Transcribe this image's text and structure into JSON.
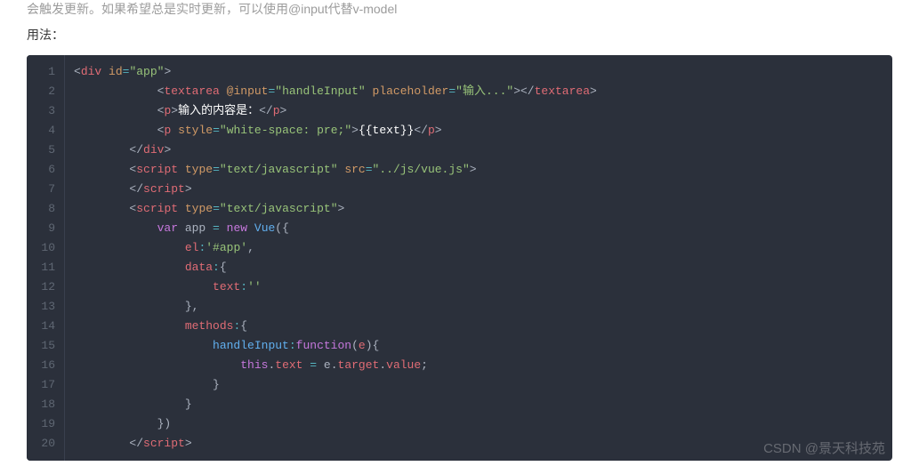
{
  "article": {
    "cutoff_text": "会触发更新。如果希望总是实时更新，可以使用@input代替v-model",
    "usage_label": "用法："
  },
  "code": {
    "line_count": 20,
    "lines": [
      {
        "n": 1,
        "tokens": [
          [
            "punc",
            "<"
          ],
          [
            "tag",
            "div"
          ],
          [
            "punc",
            " "
          ],
          [
            "attr",
            "id"
          ],
          [
            "op",
            "="
          ],
          [
            "str",
            "\"app\""
          ],
          [
            "punc",
            ">"
          ]
        ]
      },
      {
        "n": 2,
        "indent": 3,
        "tokens": [
          [
            "punc",
            "<"
          ],
          [
            "tag",
            "textarea"
          ],
          [
            "punc",
            " "
          ],
          [
            "attr",
            "@input"
          ],
          [
            "op",
            "="
          ],
          [
            "str",
            "\"handleInput\""
          ],
          [
            "punc",
            " "
          ],
          [
            "attr",
            "placeholder"
          ],
          [
            "op",
            "="
          ],
          [
            "str",
            "\"输入...\""
          ],
          [
            "punc",
            "></"
          ],
          [
            "tag",
            "textarea"
          ],
          [
            "punc",
            ">"
          ]
        ]
      },
      {
        "n": 3,
        "indent": 3,
        "tokens": [
          [
            "punc",
            "<"
          ],
          [
            "tag",
            "p"
          ],
          [
            "punc",
            ">"
          ],
          [
            "txt",
            "输入的内容是："
          ],
          [
            "punc",
            "</"
          ],
          [
            "tag",
            "p"
          ],
          [
            "punc",
            ">"
          ]
        ]
      },
      {
        "n": 4,
        "indent": 3,
        "tokens": [
          [
            "punc",
            "<"
          ],
          [
            "tag",
            "p"
          ],
          [
            "punc",
            " "
          ],
          [
            "attr",
            "style"
          ],
          [
            "op",
            "="
          ],
          [
            "str",
            "\"white-space: pre;\""
          ],
          [
            "punc",
            ">"
          ],
          [
            "txt",
            "{{text}}"
          ],
          [
            "punc",
            "</"
          ],
          [
            "tag",
            "p"
          ],
          [
            "punc",
            ">"
          ]
        ]
      },
      {
        "n": 5,
        "indent": 2,
        "tokens": [
          [
            "punc",
            "</"
          ],
          [
            "tag",
            "div"
          ],
          [
            "punc",
            ">"
          ]
        ]
      },
      {
        "n": 6,
        "indent": 2,
        "tokens": [
          [
            "punc",
            "<"
          ],
          [
            "tag",
            "script"
          ],
          [
            "punc",
            " "
          ],
          [
            "attr",
            "type"
          ],
          [
            "op",
            "="
          ],
          [
            "str",
            "\"text/javascript\""
          ],
          [
            "punc",
            " "
          ],
          [
            "attr",
            "src"
          ],
          [
            "op",
            "="
          ],
          [
            "str",
            "\"../js/vue.js\""
          ],
          [
            "punc",
            ">"
          ]
        ]
      },
      {
        "n": 7,
        "indent": 2,
        "tokens": [
          [
            "punc",
            "</"
          ],
          [
            "tag",
            "script"
          ],
          [
            "punc",
            ">"
          ]
        ]
      },
      {
        "n": 8,
        "indent": 2,
        "tokens": [
          [
            "punc",
            "<"
          ],
          [
            "tag",
            "script"
          ],
          [
            "punc",
            " "
          ],
          [
            "attr",
            "type"
          ],
          [
            "op",
            "="
          ],
          [
            "str",
            "\"text/javascript\""
          ],
          [
            "punc",
            ">"
          ]
        ]
      },
      {
        "n": 9,
        "indent": 3,
        "tokens": [
          [
            "kw",
            "var"
          ],
          [
            "punc",
            " app "
          ],
          [
            "op",
            "="
          ],
          [
            "punc",
            " "
          ],
          [
            "kw",
            "new"
          ],
          [
            "punc",
            " "
          ],
          [
            "fn",
            "Vue"
          ],
          [
            "punc",
            "({"
          ]
        ]
      },
      {
        "n": 10,
        "indent": 4,
        "tokens": [
          [
            "prop",
            "el"
          ],
          [
            "op",
            ":"
          ],
          [
            "str",
            "'#app'"
          ],
          [
            "punc",
            ","
          ]
        ]
      },
      {
        "n": 11,
        "indent": 4,
        "tokens": [
          [
            "prop",
            "data"
          ],
          [
            "op",
            ":"
          ],
          [
            "punc",
            "{"
          ]
        ]
      },
      {
        "n": 12,
        "indent": 5,
        "tokens": [
          [
            "prop",
            "text"
          ],
          [
            "op",
            ":"
          ],
          [
            "str",
            "''"
          ]
        ]
      },
      {
        "n": 13,
        "indent": 4,
        "tokens": [
          [
            "punc",
            "},"
          ]
        ]
      },
      {
        "n": 14,
        "indent": 4,
        "tokens": [
          [
            "prop",
            "methods"
          ],
          [
            "op",
            ":"
          ],
          [
            "punc",
            "{"
          ]
        ]
      },
      {
        "n": 15,
        "indent": 5,
        "tokens": [
          [
            "fn",
            "handleInput"
          ],
          [
            "op",
            ":"
          ],
          [
            "kw",
            "function"
          ],
          [
            "punc",
            "("
          ],
          [
            "prop",
            "e"
          ],
          [
            "punc",
            "){"
          ]
        ]
      },
      {
        "n": 16,
        "indent": 6,
        "tokens": [
          [
            "kw",
            "this"
          ],
          [
            "punc",
            "."
          ],
          [
            "prop",
            "text"
          ],
          [
            "punc",
            " "
          ],
          [
            "op",
            "="
          ],
          [
            "punc",
            " e"
          ],
          [
            "punc",
            "."
          ],
          [
            "prop",
            "target"
          ],
          [
            "punc",
            "."
          ],
          [
            "prop",
            "value"
          ],
          [
            "punc",
            ";"
          ]
        ]
      },
      {
        "n": 17,
        "indent": 5,
        "tokens": [
          [
            "punc",
            "}"
          ]
        ]
      },
      {
        "n": 18,
        "indent": 4,
        "tokens": [
          [
            "punc",
            "}"
          ]
        ]
      },
      {
        "n": 19,
        "indent": 3,
        "tokens": [
          [
            "punc",
            "})"
          ]
        ]
      },
      {
        "n": 20,
        "indent": 2,
        "tokens": [
          [
            "punc",
            "</"
          ],
          [
            "tag",
            "script"
          ],
          [
            "punc",
            ">"
          ]
        ]
      }
    ]
  },
  "watermark": "CSDN @景天科技苑"
}
